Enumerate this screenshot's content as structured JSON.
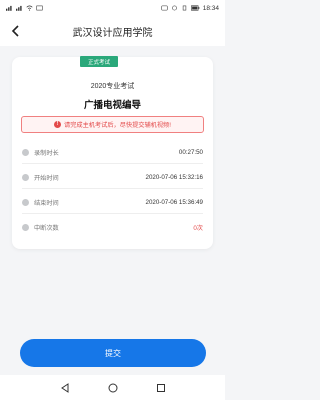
{
  "status_bar": {
    "left_text": "",
    "time": "18:34"
  },
  "nav": {
    "title": "武汉设计应用学院"
  },
  "card": {
    "badge": "正式考试",
    "exam_year": "2020专业考试",
    "exam_name": "广播电视编导",
    "warning": "请完成主机考试后，尽快提交辅机视频!",
    "rows": [
      {
        "label": "录制时长",
        "value": "00:27:50"
      },
      {
        "label": "开始时间",
        "value": "2020-07-06 15:32:16"
      },
      {
        "label": "结束时间",
        "value": "2020-07-06 15:36:49"
      },
      {
        "label": "中断次数",
        "value": "0次"
      }
    ]
  },
  "submit_label": "提交",
  "colors": {
    "accent": "#1677e8",
    "badge": "#2aa87a",
    "warning": "#e34a4a"
  }
}
